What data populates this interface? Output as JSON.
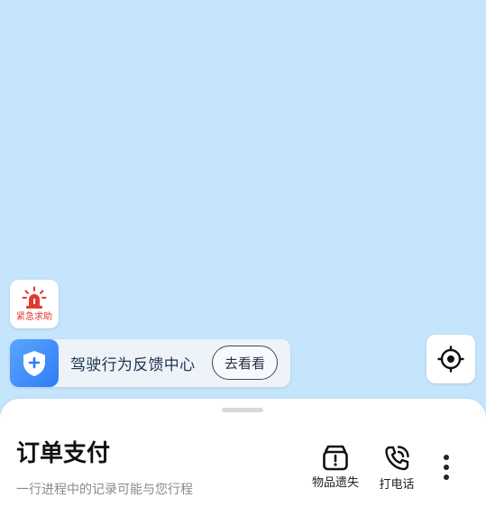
{
  "map": {
    "background_color": "#c5e5fd"
  },
  "sos": {
    "icon": "alarm-light-icon",
    "label": "紧急求助",
    "accent_color": "#e23a2f"
  },
  "feedback_banner": {
    "icon": "shield-plus-icon",
    "text": "驾驶行为反馈中心",
    "button_label": "去看看",
    "accent_color": "#2f7cf6"
  },
  "locate": {
    "icon": "locate-crosshair-icon"
  },
  "sheet": {
    "title": "订单支付",
    "subtitle": "一行进程中的记录可能与您行程",
    "actions": [
      {
        "icon": "lost-item-box-icon",
        "label": "物品遗失"
      },
      {
        "icon": "phone-call-icon",
        "label": "打电话"
      }
    ],
    "more_icon": "more-vertical-icon"
  }
}
